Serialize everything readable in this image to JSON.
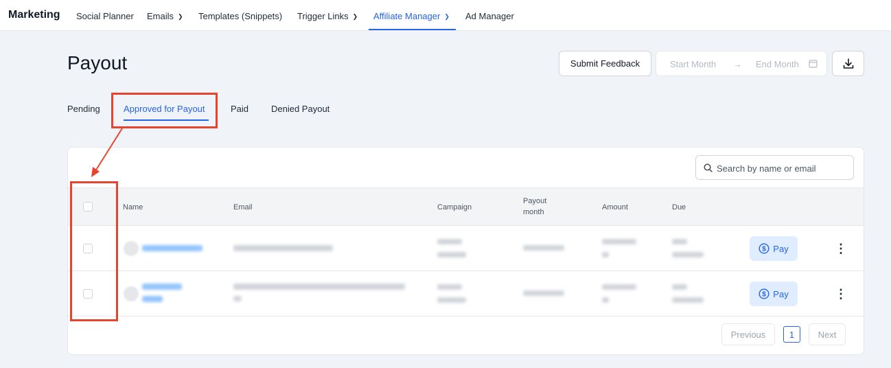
{
  "nav": {
    "brand": "Marketing",
    "items": [
      {
        "label": "Social Planner",
        "dropdown": false,
        "active": false
      },
      {
        "label": "Emails",
        "dropdown": true,
        "active": false
      },
      {
        "label": "Templates (Snippets)",
        "dropdown": false,
        "active": false
      },
      {
        "label": "Trigger Links",
        "dropdown": true,
        "active": false
      },
      {
        "label": "Affiliate Manager",
        "dropdown": true,
        "active": true
      },
      {
        "label": "Ad Manager",
        "dropdown": false,
        "active": false
      }
    ]
  },
  "header": {
    "title": "Payout",
    "feedback_label": "Submit Feedback",
    "start_month_placeholder": "Start Month",
    "end_month_placeholder": "End Month",
    "arrow": "→"
  },
  "tabs": [
    {
      "label": "Pending",
      "active": false
    },
    {
      "label": "Approved for Payout",
      "active": true
    },
    {
      "label": "Paid",
      "active": false
    },
    {
      "label": "Denied Payout",
      "active": false
    }
  ],
  "search": {
    "placeholder": "Search by name or email"
  },
  "table": {
    "columns": {
      "name": "Name",
      "email": "Email",
      "campaign": "Campaign",
      "payout_month_1": "Payout",
      "payout_month_2": "month",
      "amount": "Amount",
      "due": "Due"
    },
    "pay_label": "Pay",
    "rows": [
      {
        "note": "blurred"
      },
      {
        "note": "blurred"
      }
    ]
  },
  "pagination": {
    "previous": "Previous",
    "current": "1",
    "next": "Next"
  },
  "colors": {
    "accent": "#2563eb",
    "annotation": "#e8432e",
    "pay_bg": "#e0ecff"
  }
}
